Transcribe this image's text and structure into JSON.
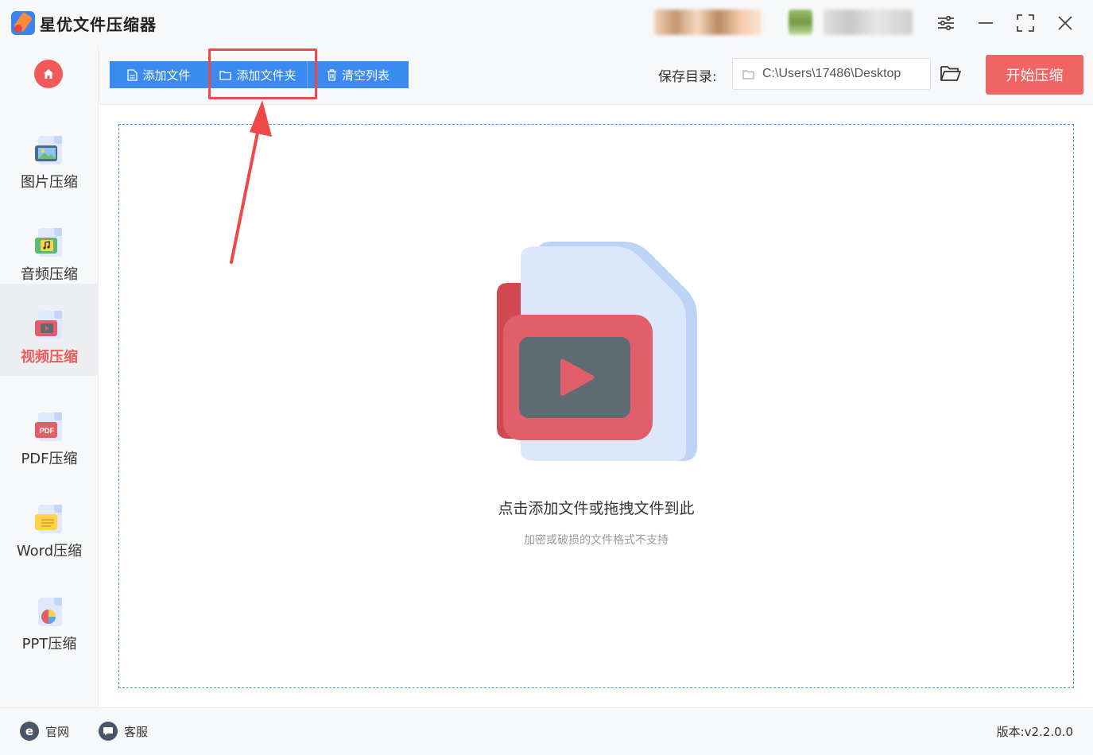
{
  "app": {
    "title": "星优文件压缩器"
  },
  "sidebar": {
    "items": [
      {
        "label": "图片压缩",
        "icon": "image-file-icon"
      },
      {
        "label": "音频压缩",
        "icon": "audio-file-icon"
      },
      {
        "label": "视频压缩",
        "icon": "video-file-icon",
        "active": true
      },
      {
        "label": "PDF压缩",
        "icon": "pdf-file-icon"
      },
      {
        "label": "Word压缩",
        "icon": "word-file-icon"
      },
      {
        "label": "PPT压缩",
        "icon": "ppt-file-icon"
      }
    ]
  },
  "toolbar": {
    "add_file": "添加文件",
    "add_folder": "添加文件夹",
    "clear_list": "清空列表",
    "save_dir_label": "保存目录:",
    "save_dir_value": "C:\\Users\\17486\\Desktop",
    "start_button": "开始压缩"
  },
  "dropzone": {
    "title": "点击添加文件或拖拽文件到此",
    "subtitle": "加密或破损的文件格式不支持"
  },
  "footer": {
    "website": "官网",
    "service": "客服",
    "version": "版本:v2.2.0.0"
  },
  "colors": {
    "accent_blue": "#3a8af0",
    "accent_red": "#f06464",
    "annotation_red": "#f04848"
  }
}
